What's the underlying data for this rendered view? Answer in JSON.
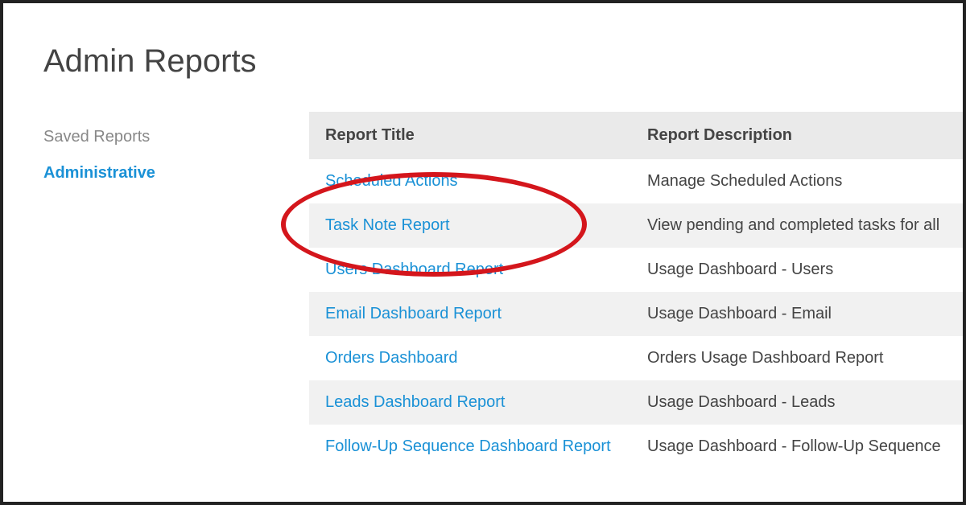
{
  "page": {
    "title": "Admin Reports"
  },
  "sidebar": {
    "items": [
      {
        "label": "Saved Reports",
        "active": false
      },
      {
        "label": "Administrative",
        "active": true
      }
    ]
  },
  "table": {
    "headers": {
      "title": "Report Title",
      "description": "Report Description"
    },
    "rows": [
      {
        "title": "Scheduled Actions",
        "description": "Manage Scheduled Actions"
      },
      {
        "title": "Task Note Report",
        "description": "View pending and completed tasks for all"
      },
      {
        "title": "Users Dashboard Report",
        "description": "Usage Dashboard - Users"
      },
      {
        "title": "Email Dashboard Report",
        "description": "Usage Dashboard - Email"
      },
      {
        "title": "Orders Dashboard",
        "description": "Orders Usage Dashboard Report"
      },
      {
        "title": "Leads Dashboard Report",
        "description": "Usage Dashboard - Leads"
      },
      {
        "title": "Follow-Up Sequence Dashboard Report",
        "description": "Usage Dashboard - Follow-Up Sequence"
      }
    ]
  },
  "annotation": {
    "highlight_row_index": 1
  }
}
